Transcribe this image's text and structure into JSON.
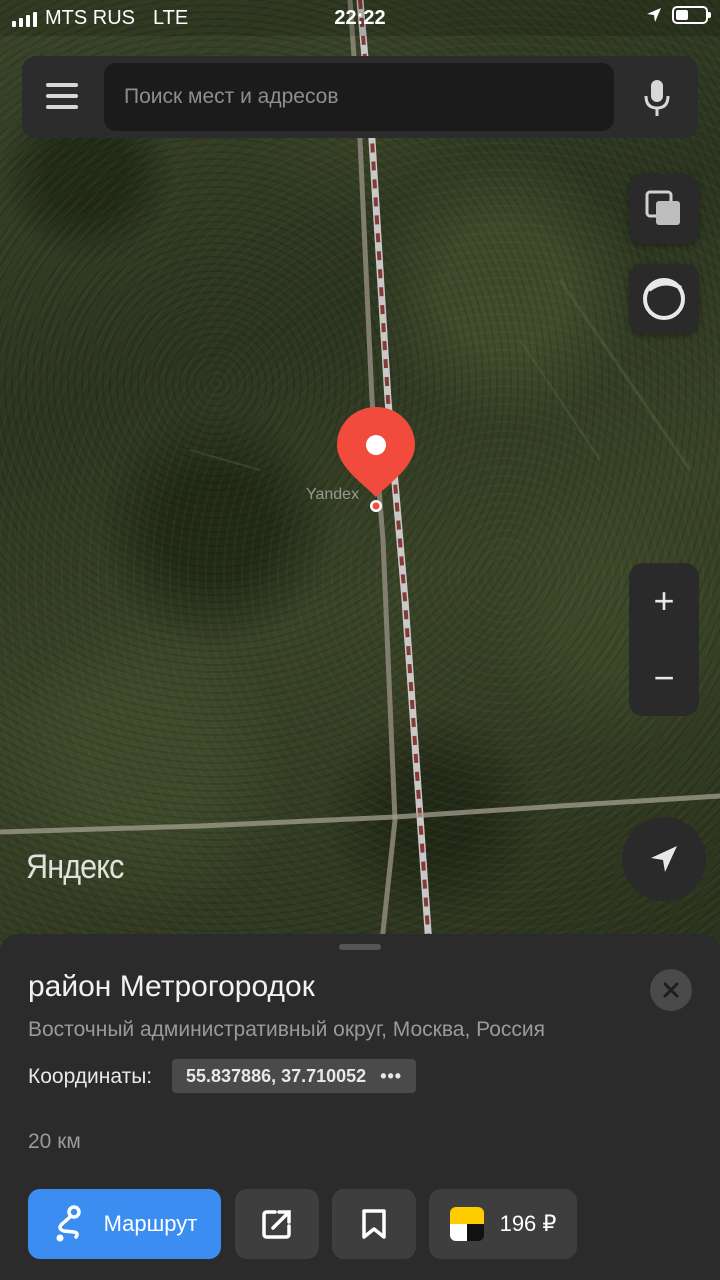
{
  "status_bar": {
    "carrier": "MTS RUS",
    "network": "LTE",
    "time": "22:22"
  },
  "search": {
    "placeholder": "Поиск мест и адресов"
  },
  "map": {
    "watermark": "Yandex",
    "logo_text": "Яндекс",
    "zoom_in_label": "+",
    "zoom_out_label": "−"
  },
  "place": {
    "title": "район Метрогородок",
    "subtitle": "Восточный административный округ, Москва, Россия",
    "coords_label": "Координаты:",
    "coords_value": "55.837886, 37.710052",
    "coords_more": "•••",
    "distance": "20 км"
  },
  "actions": {
    "route_label": "Маршрут",
    "taxi_price": "196 ₽"
  },
  "colors": {
    "accent": "#3b8df2",
    "pin": "#f04b3c",
    "sheet_bg": "#2b2b2b",
    "taxi_yellow": "#ffcc00"
  }
}
